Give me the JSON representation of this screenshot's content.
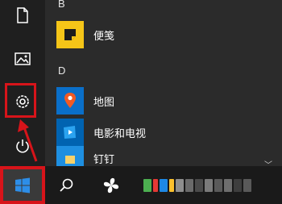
{
  "start_menu": {
    "rail": {
      "items": [
        {
          "name": "documents-icon"
        },
        {
          "name": "pictures-icon"
        },
        {
          "name": "settings-icon"
        },
        {
          "name": "power-icon"
        }
      ]
    },
    "sections": [
      {
        "letter": "B",
        "apps": [
          {
            "label": "便笺",
            "icon": "sticky-notes-icon",
            "color": "#f5c518"
          }
        ]
      },
      {
        "letter": "D",
        "apps": [
          {
            "label": "地图",
            "icon": "maps-icon",
            "color": "#0a6fc9"
          },
          {
            "label": "电影和电视",
            "icon": "movies-tv-icon",
            "color": "#0063b1"
          },
          {
            "label": "钉钉",
            "icon": "dingtalk-icon",
            "color": "#1e8fe1"
          }
        ]
      }
    ]
  },
  "taskbar": {
    "start_icon": "windows-logo-icon",
    "search_icon": "search-icon",
    "task_view_icon": "pinwheel-app-icon"
  },
  "colors": {
    "highlight": "#d7141a",
    "menu_bg": "#2b2b2b",
    "taskbar_bg": "#1a1a1a"
  }
}
